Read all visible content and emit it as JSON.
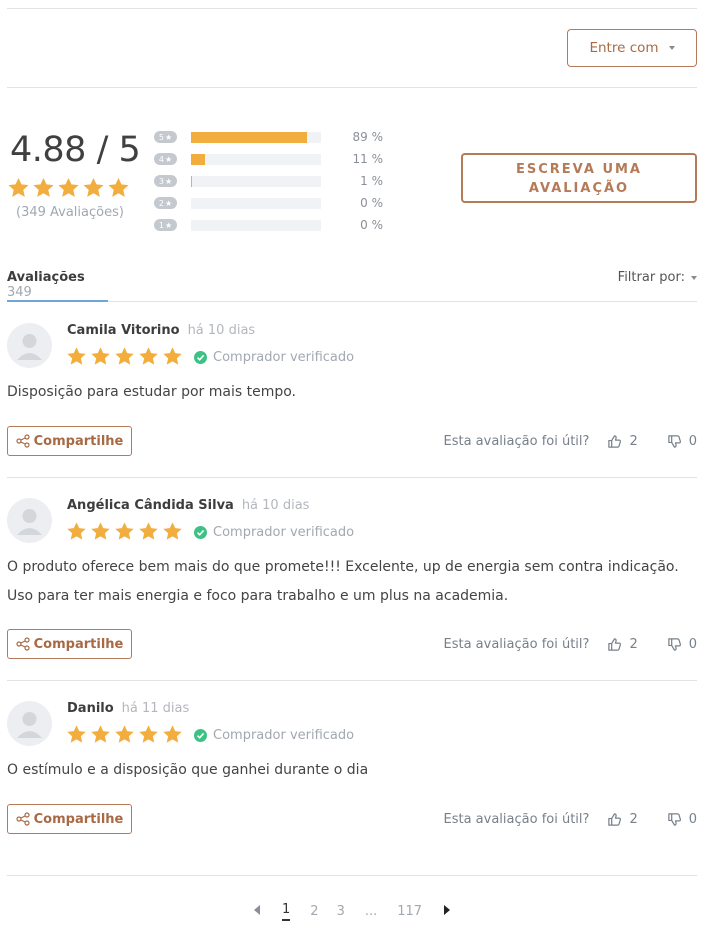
{
  "header": {
    "login_label": "Entre com"
  },
  "summary": {
    "average": "4.88",
    "max": "5",
    "count_label": "(349 Avaliações)",
    "write_review_label": "ESCREVA UMA AVALIAÇÃO",
    "distribution": [
      {
        "stars": "5",
        "percent": 89,
        "percent_label": "89 %"
      },
      {
        "stars": "4",
        "percent": 11,
        "percent_label": "11 %"
      },
      {
        "stars": "3",
        "percent": 1,
        "percent_label": "1 %"
      },
      {
        "stars": "2",
        "percent": 0,
        "percent_label": "0 %"
      },
      {
        "stars": "1",
        "percent": 0,
        "percent_label": "0 %"
      }
    ]
  },
  "tabs": {
    "reviews_label": "Avaliações",
    "reviews_count": "349",
    "filter_label": "Filtrar por:"
  },
  "reviews": [
    {
      "name": "Camila Vitorino",
      "date": "há 10 dias",
      "rating": 5,
      "verified_label": "Comprador verificado",
      "text": [
        "Disposição para estudar por mais tempo."
      ],
      "share_label": "Compartilhe",
      "helpful_label": "Esta avaliação foi útil?",
      "up": "2",
      "down": "0"
    },
    {
      "name": "Angélica Cândida Silva",
      "date": "há 10 dias",
      "rating": 5,
      "verified_label": "Comprador verificado",
      "text": [
        "O produto oferece bem mais do que promete!!! Excelente, up de energia sem contra indicação.",
        "Uso para ter mais energia e foco para trabalho e um plus na academia."
      ],
      "share_label": "Compartilhe",
      "helpful_label": "Esta avaliação foi útil?",
      "up": "2",
      "down": "0"
    },
    {
      "name": "Danilo",
      "date": "há 11 dias",
      "rating": 5,
      "verified_label": "Comprador verificado",
      "text": [
        "O estímulo e a disposição que ganhei durante o dia"
      ],
      "share_label": "Compartilhe",
      "helpful_label": "Esta avaliação foi útil?",
      "up": "2",
      "down": "0"
    }
  ],
  "pagination": {
    "current": "1",
    "pages": [
      "1",
      "2",
      "3"
    ],
    "ellipsis": "...",
    "last": "117"
  },
  "colors": {
    "star": "#f2ad3f",
    "accent": "#b57a57",
    "verified": "#3ec184",
    "tab_underline": "#6ea6d8"
  }
}
